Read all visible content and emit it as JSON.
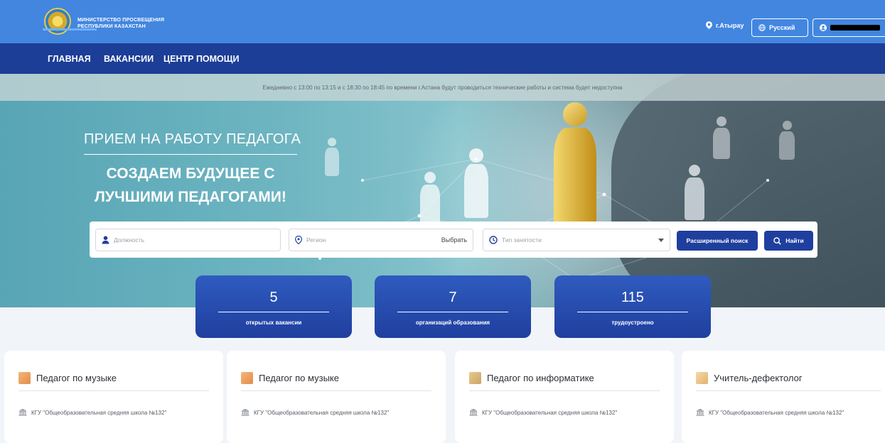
{
  "header": {
    "ministry_line1": "МИНИСТЕРСТВО ПРОСВЕЩЕНИЯ",
    "ministry_line2": "РЕСПУБЛИКИ КАЗАХСТАН",
    "city": "г.Атырау",
    "language": "Русский",
    "icons": [
      "emblem-icon",
      "location-pin-icon",
      "globe-icon",
      "user-icon"
    ]
  },
  "nav": {
    "items": [
      {
        "label": "ГЛАВНАЯ",
        "active": true
      },
      {
        "label": "ВАКАНСИИ",
        "active": false
      },
      {
        "label": "ЦЕНТР ПОМОЩИ",
        "active": false
      }
    ]
  },
  "notice": "Ежедневно с 13:00 по 13:15 и с 18:30 по 18:45 по времени г.Астана будут проводиться технические работы и система будет недоступна",
  "hero": {
    "slogan1": "ПРИЕМ НА РАБОТУ ПЕДАГОГА",
    "slogan2_line1": "СОЗДАЕМ БУДУЩЕЕ С",
    "slogan2_line2": "ЛУЧШИМИ ПЕДАГОГАМИ!"
  },
  "search": {
    "position_placeholder": "Должность",
    "region_placeholder": "Регион",
    "region_pick": "Выбрать",
    "employment_placeholder": "Тип занятости",
    "advanced_label": "Расширенный поиск",
    "find_label": "Найти"
  },
  "stats": [
    {
      "value": "5",
      "label": "открытых вакансии"
    },
    {
      "value": "7",
      "label": "организаций образования"
    },
    {
      "value": "115",
      "label": "трудоустроено"
    }
  ],
  "cards": [
    {
      "title": "Педагог по музыке",
      "org": "КГУ \"Общеобразовательная средняя школа №132\""
    },
    {
      "title": "Педагог по музыке",
      "org": "КГУ \"Общеобразовательная средняя школа №132\""
    },
    {
      "title": "Педагог по информатике",
      "org": "КГУ \"Общеобразовательная средняя школа №132\""
    },
    {
      "title": "Учитель-дефектолог",
      "org": "КГУ \"Общеобразовательная средняя школа №132\""
    }
  ],
  "colors": {
    "topbar": "#4286e0",
    "nav": "#1c3e97",
    "accent": "#1f3f9e"
  }
}
